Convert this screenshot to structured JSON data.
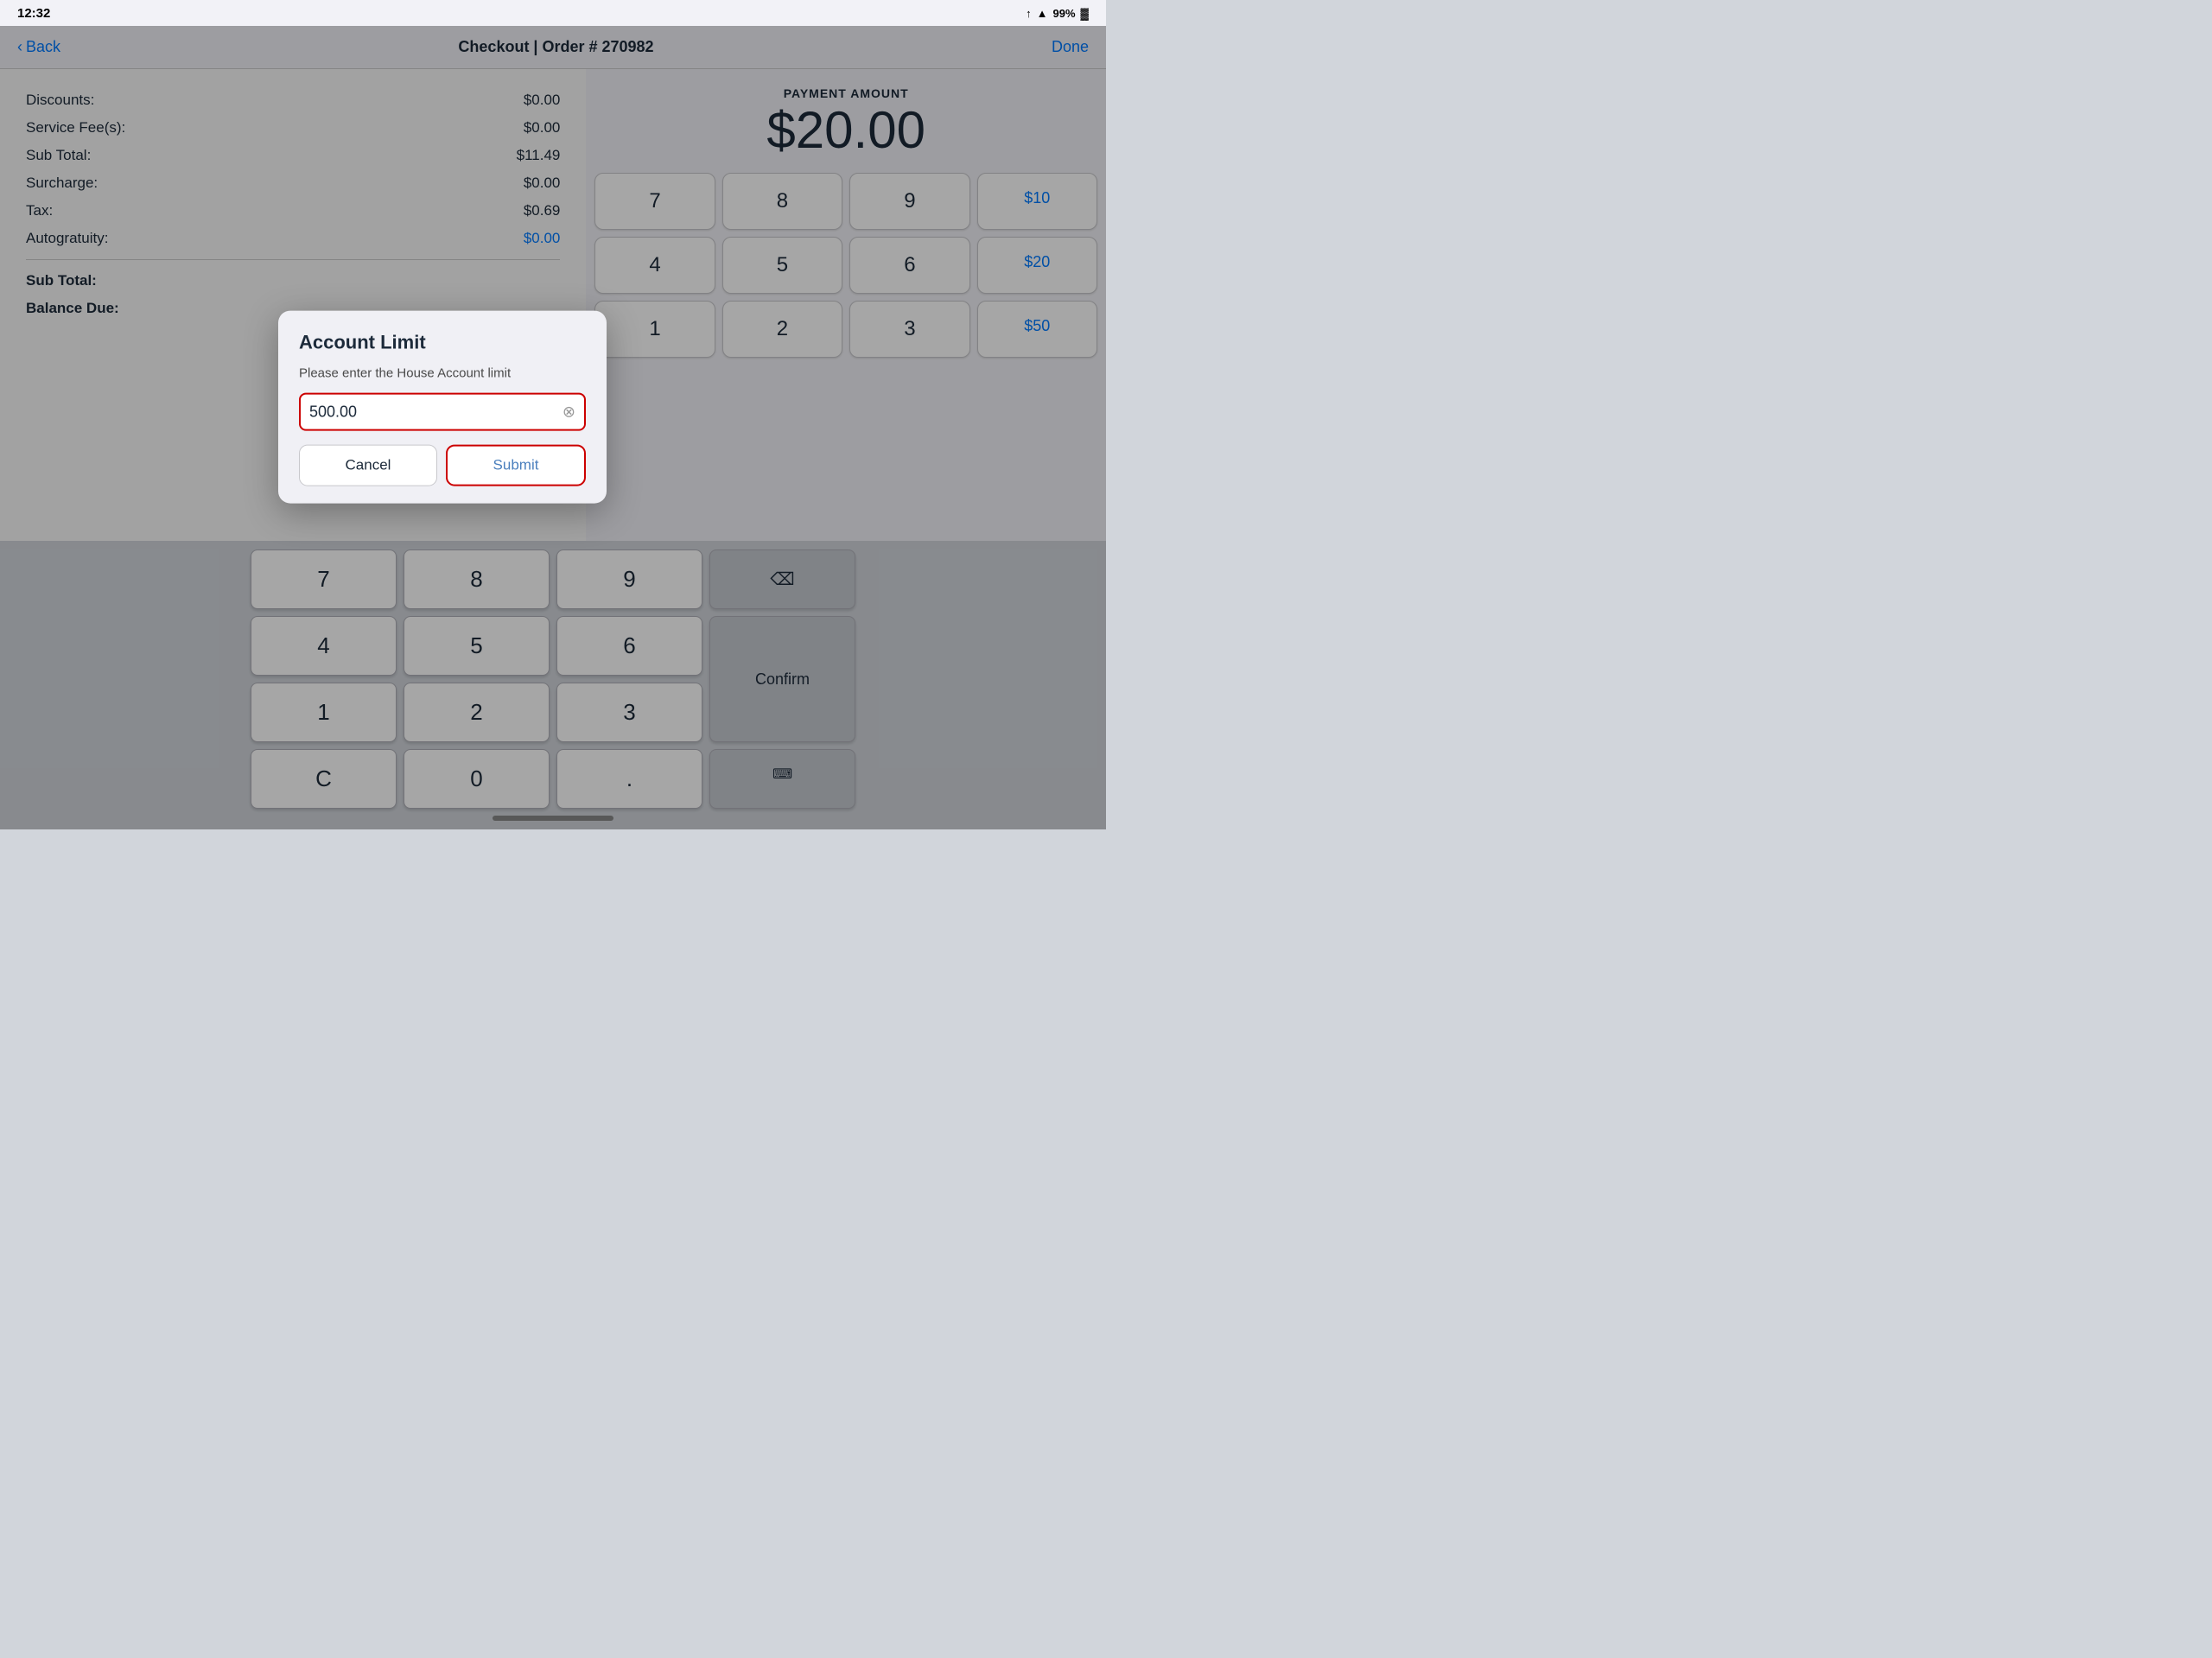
{
  "statusBar": {
    "time": "12:32",
    "location": "↑",
    "wifi": "wifi",
    "battery": "99%"
  },
  "navBar": {
    "backLabel": "Back",
    "title": "Checkout | Order # 270982",
    "doneLabel": "Done"
  },
  "orderSummary": {
    "rows": [
      {
        "label": "Discounts:",
        "value": "$0.00",
        "blue": false
      },
      {
        "label": "Service Fee(s):",
        "value": "$0.00",
        "blue": false
      },
      {
        "label": "Sub Total:",
        "value": "$11.49",
        "blue": false
      },
      {
        "label": "Surcharge:",
        "value": "$0.00",
        "blue": false
      },
      {
        "label": "Tax:",
        "value": "$0.69",
        "blue": false
      },
      {
        "label": "Autogratuity:",
        "value": "$0.00",
        "blue": true
      }
    ],
    "subTotalLabel": "Sub Total:",
    "balanceDueLabel": "Balance Due:"
  },
  "payment": {
    "amountLabel": "PAYMENT AMOUNT",
    "amountValue": "$20.00"
  },
  "numpad": {
    "buttons": [
      "7",
      "8",
      "9",
      "$10",
      "4",
      "5",
      "6",
      "$20",
      "1",
      "2",
      "3",
      "$50"
    ],
    "confirmLabel": "Confirm",
    "backspaceSymbol": "⌫"
  },
  "dialog": {
    "title": "Account Limit",
    "message": "Please enter the House Account limit",
    "inputValue": "500.00",
    "inputPlaceholder": "",
    "cancelLabel": "Cancel",
    "submitLabel": "Submit"
  },
  "keyboard": {
    "rows": [
      [
        "7",
        "8",
        "9"
      ],
      [
        "4",
        "5",
        "6"
      ],
      [
        "1",
        "2",
        "3"
      ],
      [
        "C",
        "0",
        "."
      ]
    ],
    "backspaceLabel": "⌫",
    "confirmLabel": "Confirm",
    "keyboardIconLabel": "⌨"
  }
}
